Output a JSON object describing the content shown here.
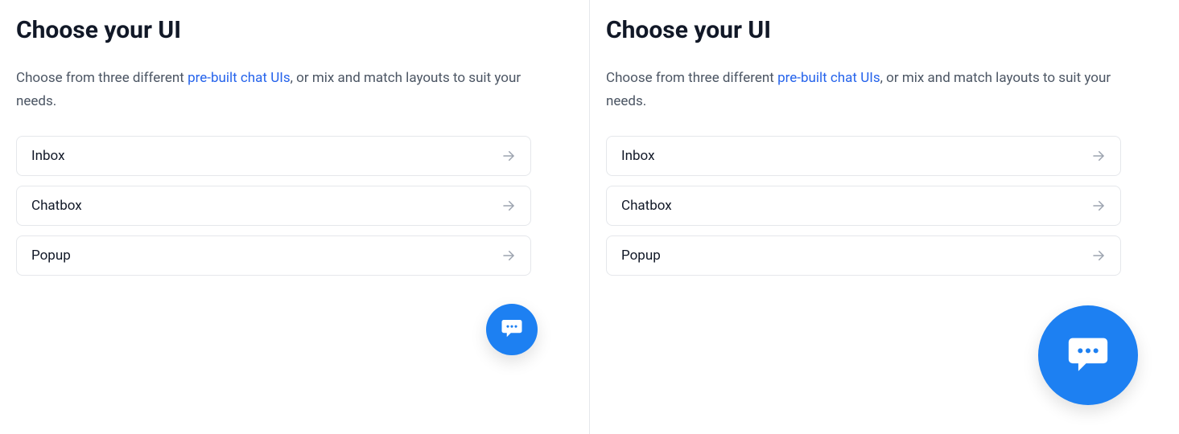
{
  "left": {
    "title": "Choose your UI",
    "description_prefix": "Choose from three different ",
    "description_link": "pre-built chat UIs",
    "description_suffix": ", or mix and match layouts to suit your needs.",
    "options": [
      {
        "label": "Inbox"
      },
      {
        "label": "Chatbox"
      },
      {
        "label": "Popup"
      }
    ]
  },
  "right": {
    "title": "Choose your UI",
    "description_prefix": "Choose from three different ",
    "description_link": "pre-built chat UIs",
    "description_suffix": ", or mix and match layouts to suit your needs.",
    "options": [
      {
        "label": "Inbox"
      },
      {
        "label": "Chatbox"
      },
      {
        "label": "Popup"
      }
    ]
  },
  "colors": {
    "accent": "#1d80f2",
    "link": "#2563eb",
    "border": "#e5e7eb",
    "text_primary": "#111827",
    "text_secondary": "#4b5563",
    "icon_muted": "#9ca3af"
  }
}
